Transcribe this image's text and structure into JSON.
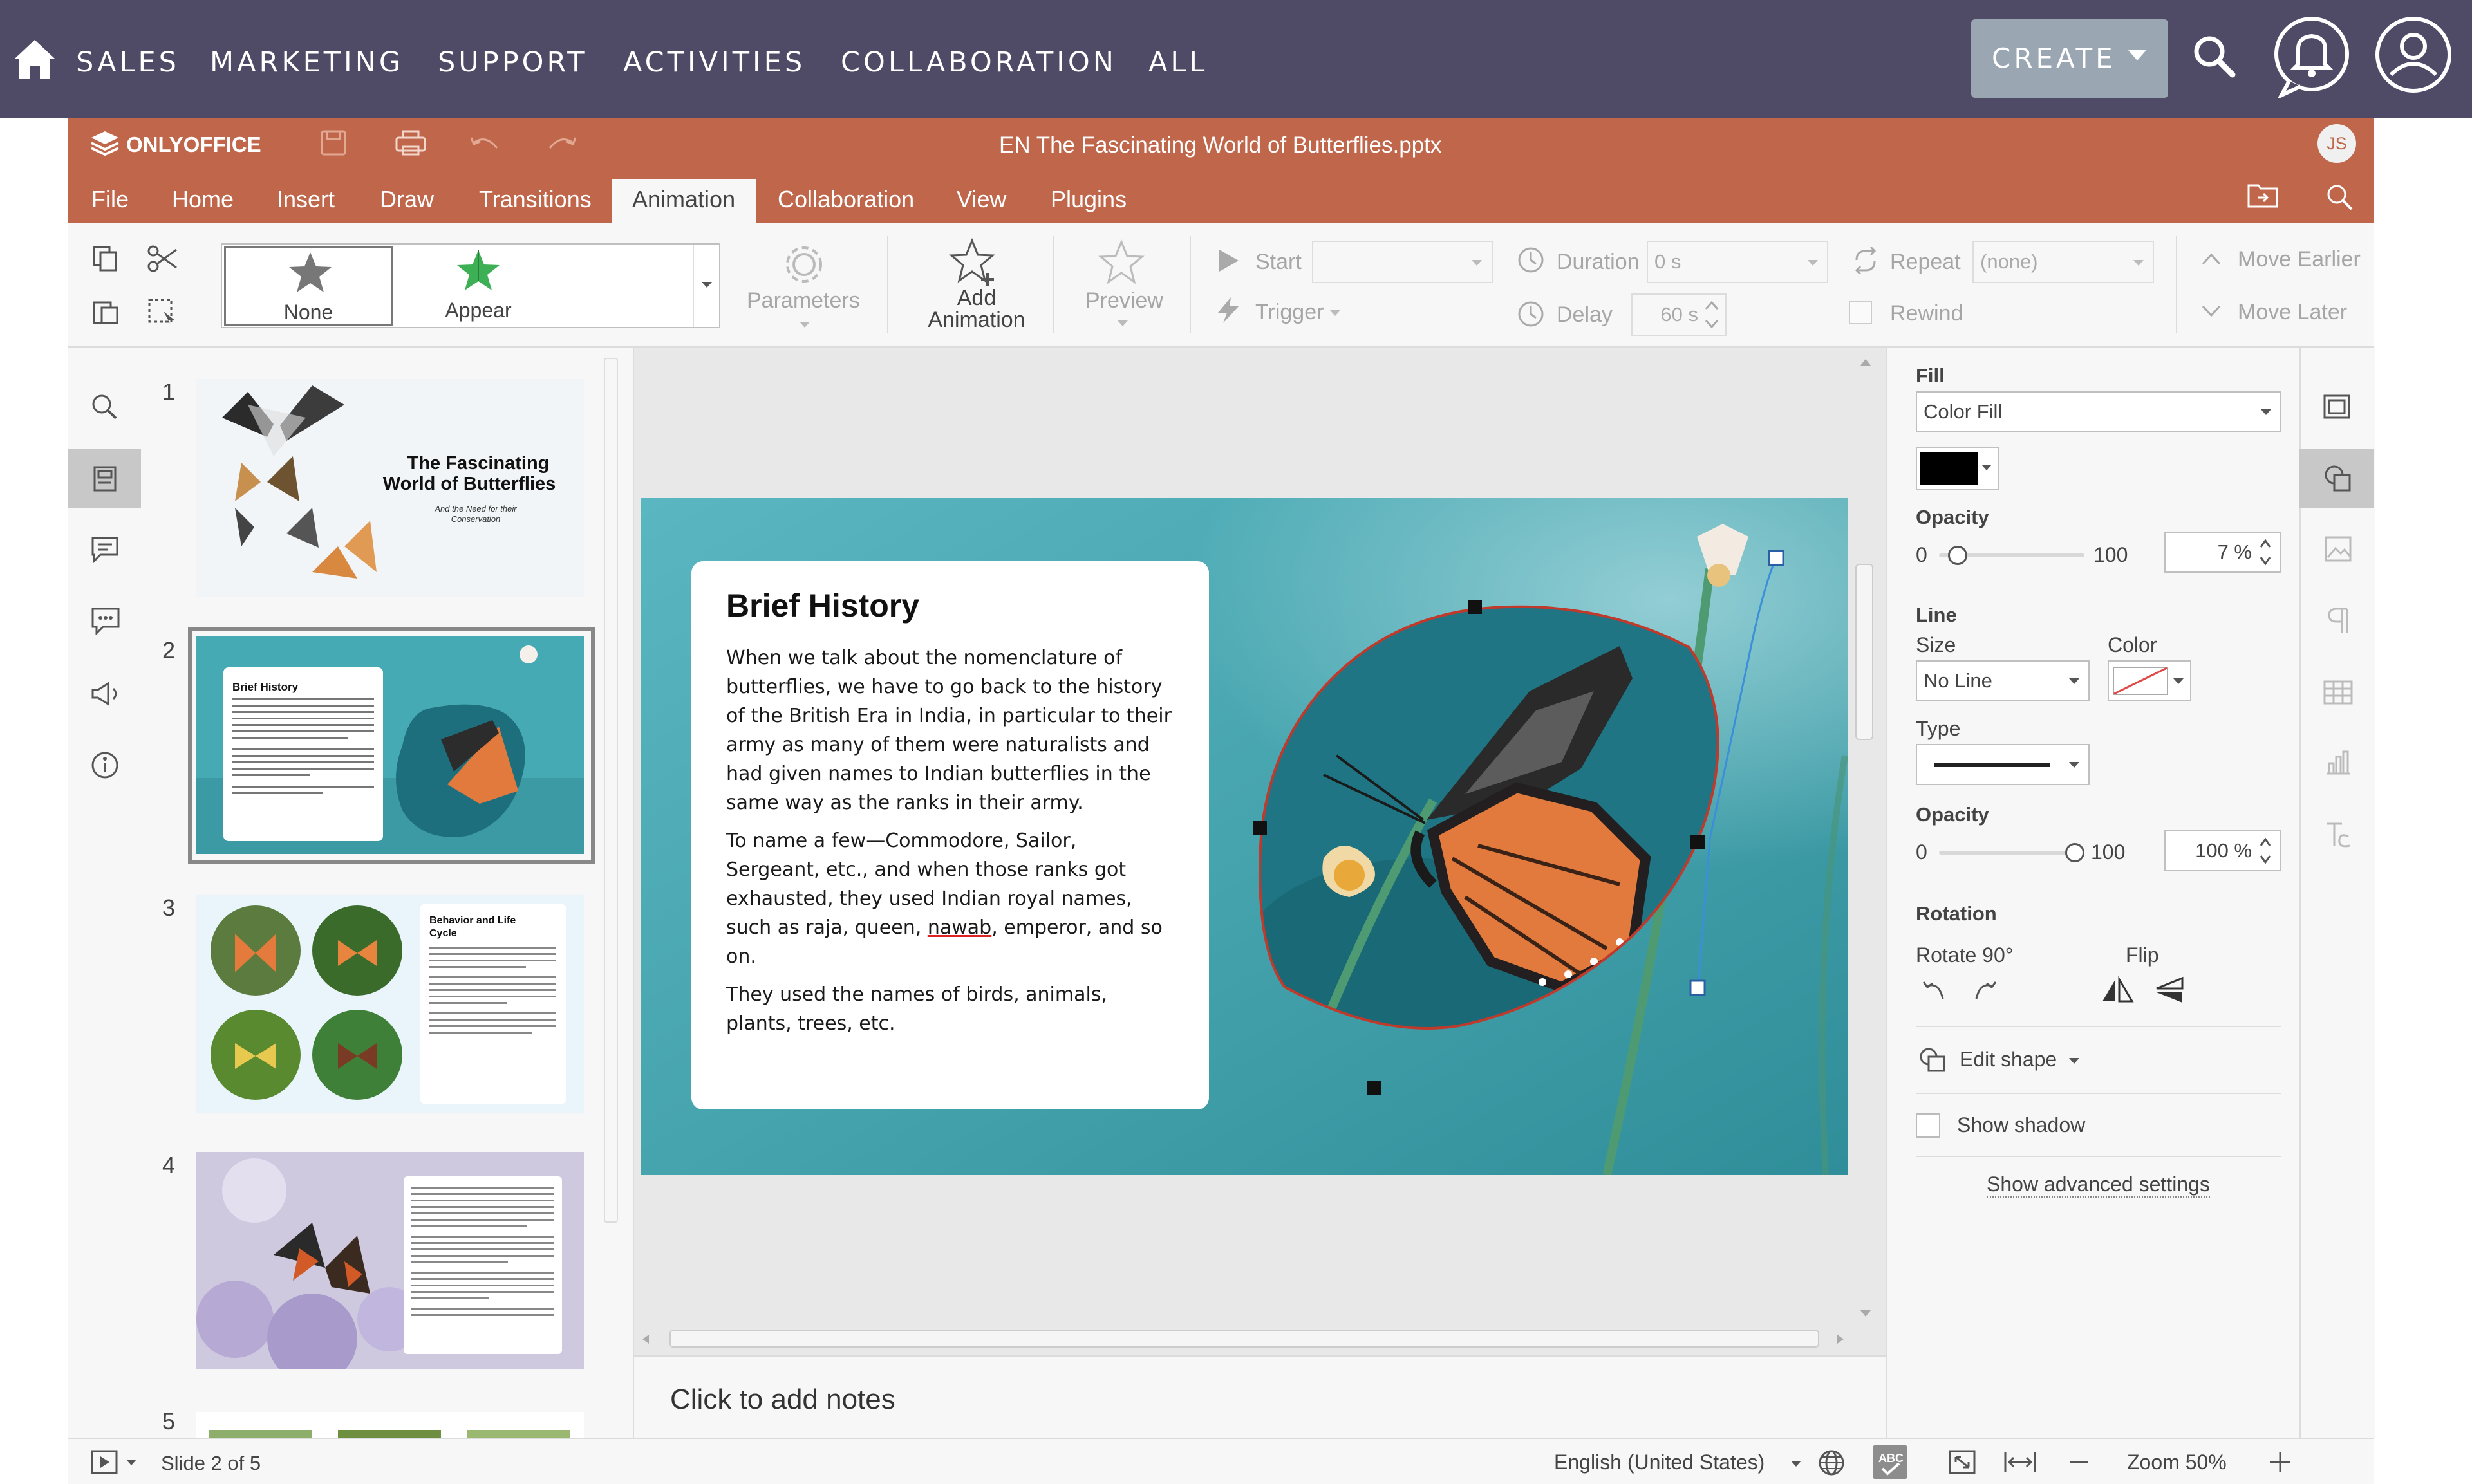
{
  "topnav": {
    "links": [
      "SALES",
      "MARKETING",
      "SUPPORT",
      "ACTIVITIES",
      "COLLABORATION",
      "ALL"
    ],
    "create_label": "CREATE"
  },
  "editor": {
    "brand": "ONLYOFFICE",
    "file_title": "EN The Fascinating World of Butterflies.pptx",
    "user_initials": "JS",
    "tabs": [
      "File",
      "Home",
      "Insert",
      "Draw",
      "Transitions",
      "Animation",
      "Collaboration",
      "View",
      "Plugins"
    ],
    "active_tab": "Animation"
  },
  "toolbar": {
    "effects": [
      "None",
      "Appear"
    ],
    "parameters_label": "Parameters",
    "add_animation_label": "Add Animation",
    "preview_label": "Preview",
    "start_label": "Start",
    "trigger_label": "Trigger",
    "duration_label": "Duration",
    "duration_value": "0 s",
    "delay_label": "Delay",
    "delay_value": "60 s",
    "repeat_label": "Repeat",
    "repeat_value": "(none)",
    "rewind_label": "Rewind",
    "move_earlier_label": "Move Earlier",
    "move_later_label": "Move Later"
  },
  "slides": {
    "numbers": [
      "1",
      "2",
      "3",
      "4",
      "5"
    ],
    "slide1_title": "The Fascinating World of Butterflies",
    "slide1_subtitle": "And the Need for their Conservation",
    "slide2_title": "Brief History",
    "slide3_title": "Behavior and Life Cycle"
  },
  "slide": {
    "title": "Brief History",
    "para1": "When we talk about the nomenclature of butterflies, we have to go back to the history of the British Era in India, in particular to their army as many of them were naturalists and had given names to Indian butterflies in the same way as the ranks in their army.",
    "para2_before": "To name a few—Commodore, Sailor, Sergeant, etc., and when those ranks got exhausted, they used Indian royal names, such as raja, queen, ",
    "para2_underlined": "nawab",
    "para2_after": ", emperor, and so on.",
    "para3": "They used the names of birds, animals, plants, trees, etc."
  },
  "notes_placeholder": "Click to add notes",
  "shape_settings": {
    "fill_label": "Fill",
    "fill_type": "Color Fill",
    "fill_color": "#000000",
    "opacity_label": "Opacity",
    "fill_opacity_min": "0",
    "fill_opacity_max": "100",
    "fill_opacity_value": "7 %",
    "fill_opacity_fraction": 0.07,
    "line_label": "Line",
    "size_label": "Size",
    "color_label": "Color",
    "line_size": "No Line",
    "type_label": "Type",
    "line_opacity_min": "0",
    "line_opacity_max": "100",
    "line_opacity_value": "100 %",
    "line_opacity_fraction": 1.0,
    "rotation_label": "Rotation",
    "rotate90_label": "Rotate 90°",
    "flip_label": "Flip",
    "edit_shape_label": "Edit shape",
    "show_shadow_label": "Show shadow",
    "advanced_label": "Show advanced settings"
  },
  "statusbar": {
    "slide_counter": "Slide 2 of 5",
    "language": "English (United States)",
    "zoom": "Zoom 50%"
  },
  "colors": {
    "topnav_bg": "#4f4a66",
    "titlebar_bg": "#c0674b",
    "create_button_bg": "#9aa6b2",
    "shape_outline": "#c0392b",
    "rotation_handle_line": "#3b8fd9"
  },
  "icons": {
    "topnav": [
      "home-icon",
      "search-icon",
      "bell-icon",
      "user-icon"
    ],
    "left_panel": [
      "search-icon",
      "slides-icon",
      "comments-icon",
      "chat-icon",
      "feedback-icon",
      "info-icon"
    ],
    "right_panel": [
      "slide-settings-icon",
      "shape-settings-icon",
      "image-settings-icon",
      "paragraph-settings-icon",
      "table-settings-icon",
      "chart-settings-icon",
      "textart-settings-icon"
    ]
  }
}
